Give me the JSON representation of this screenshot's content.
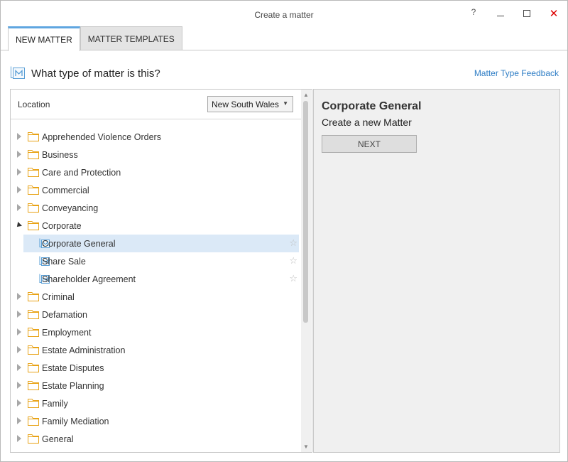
{
  "window": {
    "title": "Create a matter",
    "help_label": "?"
  },
  "tabs": [
    {
      "label": "NEW MATTER",
      "active": true
    },
    {
      "label": "MATTER TEMPLATES",
      "active": false
    }
  ],
  "header": {
    "question": "What type of matter is this?",
    "feedback_link": "Matter Type Feedback"
  },
  "location": {
    "label": "Location",
    "selected": "New South Wales"
  },
  "tree": [
    {
      "label": "Apprehended Violence Orders",
      "type": "folder",
      "expanded": false
    },
    {
      "label": "Business",
      "type": "folder",
      "expanded": false
    },
    {
      "label": "Care and Protection",
      "type": "folder",
      "expanded": false
    },
    {
      "label": "Commercial",
      "type": "folder",
      "expanded": false
    },
    {
      "label": "Conveyancing",
      "type": "folder",
      "expanded": false
    },
    {
      "label": "Corporate",
      "type": "folder",
      "expanded": true
    },
    {
      "label": "Corporate General",
      "type": "matter",
      "selected": true
    },
    {
      "label": "Share Sale",
      "type": "matter",
      "selected": false
    },
    {
      "label": "Shareholder Agreement",
      "type": "matter",
      "selected": false
    },
    {
      "label": "Criminal",
      "type": "folder",
      "expanded": false
    },
    {
      "label": "Defamation",
      "type": "folder",
      "expanded": false
    },
    {
      "label": "Employment",
      "type": "folder",
      "expanded": false
    },
    {
      "label": "Estate Administration",
      "type": "folder",
      "expanded": false
    },
    {
      "label": "Estate Disputes",
      "type": "folder",
      "expanded": false
    },
    {
      "label": "Estate Planning",
      "type": "folder",
      "expanded": false
    },
    {
      "label": "Family",
      "type": "folder",
      "expanded": false
    },
    {
      "label": "Family Mediation",
      "type": "folder",
      "expanded": false
    },
    {
      "label": "General",
      "type": "folder",
      "expanded": false
    }
  ],
  "detail": {
    "title": "Corporate General",
    "subtitle": "Create a new Matter",
    "next_label": "NEXT"
  },
  "colors": {
    "accent": "#5fa6e0",
    "link": "#2e7dc5",
    "folder": "#e8a317",
    "selected_row": "#dbe9f7",
    "close": "#dd0000"
  },
  "icons": {
    "folder": "folder-icon",
    "matter": "matter-type-icon",
    "favorite": "star-icon"
  }
}
